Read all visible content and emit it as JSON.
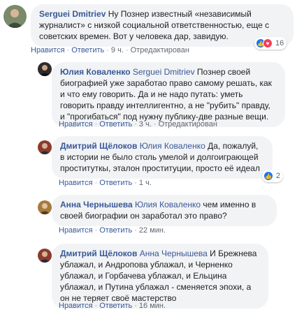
{
  "comments": [
    {
      "author": "Serguei Dmitriev",
      "text": "Ну Познер известный «независимый журналист» с низкой социальной ответственностью, еще с советских времен. Вот у человека дар, завидую.",
      "actions": {
        "like": "Нравится",
        "reply": "Ответить",
        "time": "9 ч.",
        "edited": "Отредактирован"
      },
      "reactions": {
        "count": "16"
      }
    },
    {
      "author": "Юлия Коваленко",
      "mention": "Serguei Dmitriev",
      "text": "Познер своей биографией уже заработао право самому решать, как и что ему говорить. Да и не надо путать: уметь говорить правду интеллигентно, а не \"рубить\" правду, и \"прогибаться\" под нужну публику-две разные вещи.",
      "actions": {
        "like": "Нравится",
        "reply": "Ответить",
        "time": "3 ч.",
        "edited": "Отредактирован"
      }
    },
    {
      "author": "Дмитрий Щёлоков",
      "mention": "Юлия Коваленко",
      "text": "Да, пожалуй, в истории не было столь умелой и долгоиграющей проституткы, эталон проституции, просто её идеал",
      "actions": {
        "like": "Нравится",
        "reply": "Ответить",
        "time": "1 ч."
      },
      "reactions": {
        "count": "2"
      }
    },
    {
      "author": "Анна Чернышева",
      "mention": "Юлия Коваленко",
      "text": "чем именно в своей биографии он заработал это право?",
      "actions": {
        "like": "Нравится",
        "reply": "Ответить",
        "time": "22 мин."
      }
    },
    {
      "author": "Дмитрий Щёлоков",
      "mention": "Анна Чернышева",
      "text": "И Брежнева ублажал, и Андропова ублажал, и Черненко ублажал, и Горбачева ублажал, и Ельцина ублажал, и Путина ублажал - сменяется эпохи, а он не теряет своё мастерство",
      "actions": {
        "like": "Нравится",
        "reply": "Ответить",
        "time": "16 мин."
      }
    }
  ],
  "colors": {
    "link": "#385898",
    "bubble": "#f2f3f5",
    "meta": "#606770",
    "like": "#1877f2",
    "love": "#f33e58"
  },
  "icons": {
    "like": "like-icon",
    "love": "love-icon",
    "avatar": "user-avatar"
  }
}
